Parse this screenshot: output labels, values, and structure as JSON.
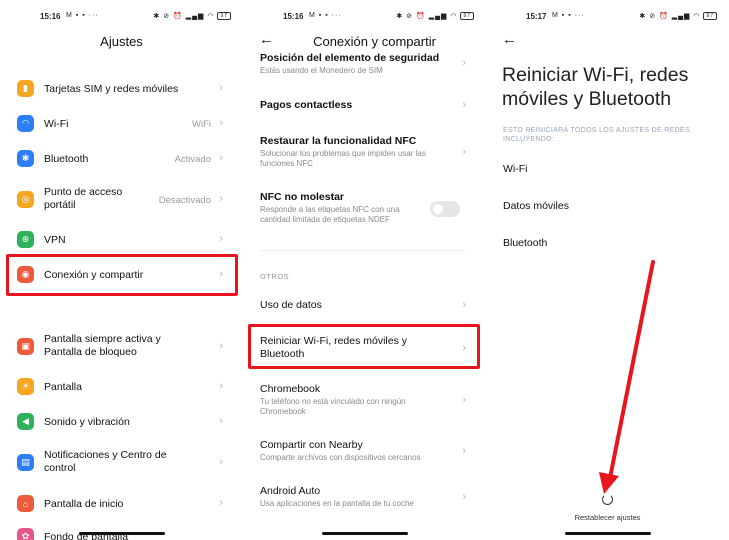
{
  "colors": {
    "highlight": "#e8151c",
    "orange": "#f5a623",
    "blue": "#2d7ff9",
    "green": "#2eb25a",
    "red": "#ee5a3c"
  },
  "status": [
    {
      "time": "15:16",
      "battery": "97"
    },
    {
      "time": "15:16",
      "battery": "97"
    },
    {
      "time": "15:17",
      "battery": "97"
    }
  ],
  "panel1": {
    "title": "Ajustes",
    "items": [
      {
        "label": "Tarjetas SIM y redes móviles",
        "value": ""
      },
      {
        "label": "Wi-Fi",
        "value": "WiFi"
      },
      {
        "label": "Bluetooth",
        "value": "Activado"
      },
      {
        "label": "Punto de acceso portátil",
        "value": "Desactivado"
      },
      {
        "label": "VPN",
        "value": ""
      },
      {
        "label": "Conexión y compartir",
        "value": ""
      },
      {
        "label": "Pantalla siempre activa y Pantalla de bloqueo",
        "value": ""
      },
      {
        "label": "Pantalla",
        "value": ""
      },
      {
        "label": "Sonido y vibración",
        "value": ""
      },
      {
        "label": "Notificaciones y Centro de control",
        "value": ""
      },
      {
        "label": "Pantalla de inicio",
        "value": ""
      },
      {
        "label": "Fondo de pantalla",
        "value": ""
      }
    ]
  },
  "panel2": {
    "title": "Conexión y compartir",
    "top_partial": {
      "title": "Posición del elemento de seguridad",
      "sub": "Estás usando el Monedero de SIM"
    },
    "items": [
      {
        "title": "Pagos contactless",
        "sub": ""
      },
      {
        "title": "Restaurar la funcionalidad NFC",
        "sub": "Solucionar los problemas que impiden usar las funciones NFC"
      },
      {
        "title": "NFC no molestar",
        "sub": "Responde a las etiquetas NFC con una cantidad limitada de etiquetas NDEF"
      }
    ],
    "section": "OTROS",
    "others": [
      {
        "title": "Uso de datos",
        "sub": ""
      },
      {
        "title": "Reiniciar Wi-Fi, redes móviles y Bluetooth",
        "sub": ""
      },
      {
        "title": "Chromebook",
        "sub": "Tu teléfono no está vinculado con ningún Chromebook"
      },
      {
        "title": "Compartir con Nearby",
        "sub": "Comparte archivos con dispositivos cercanos"
      },
      {
        "title": "Android Auto",
        "sub": "Usa aplicaciones en la pantalla de tu coche"
      }
    ]
  },
  "panel3": {
    "title": "Reiniciar Wi-Fi, redes móviles y Bluetooth",
    "caption": "ESTO REINICIARÁ TODOS LOS AJUSTES DE REDES, INCLUYENDO:",
    "items": [
      "Wi-Fi",
      "Datos móviles",
      "Bluetooth"
    ],
    "reset_label": "Restablecer ajustes"
  }
}
